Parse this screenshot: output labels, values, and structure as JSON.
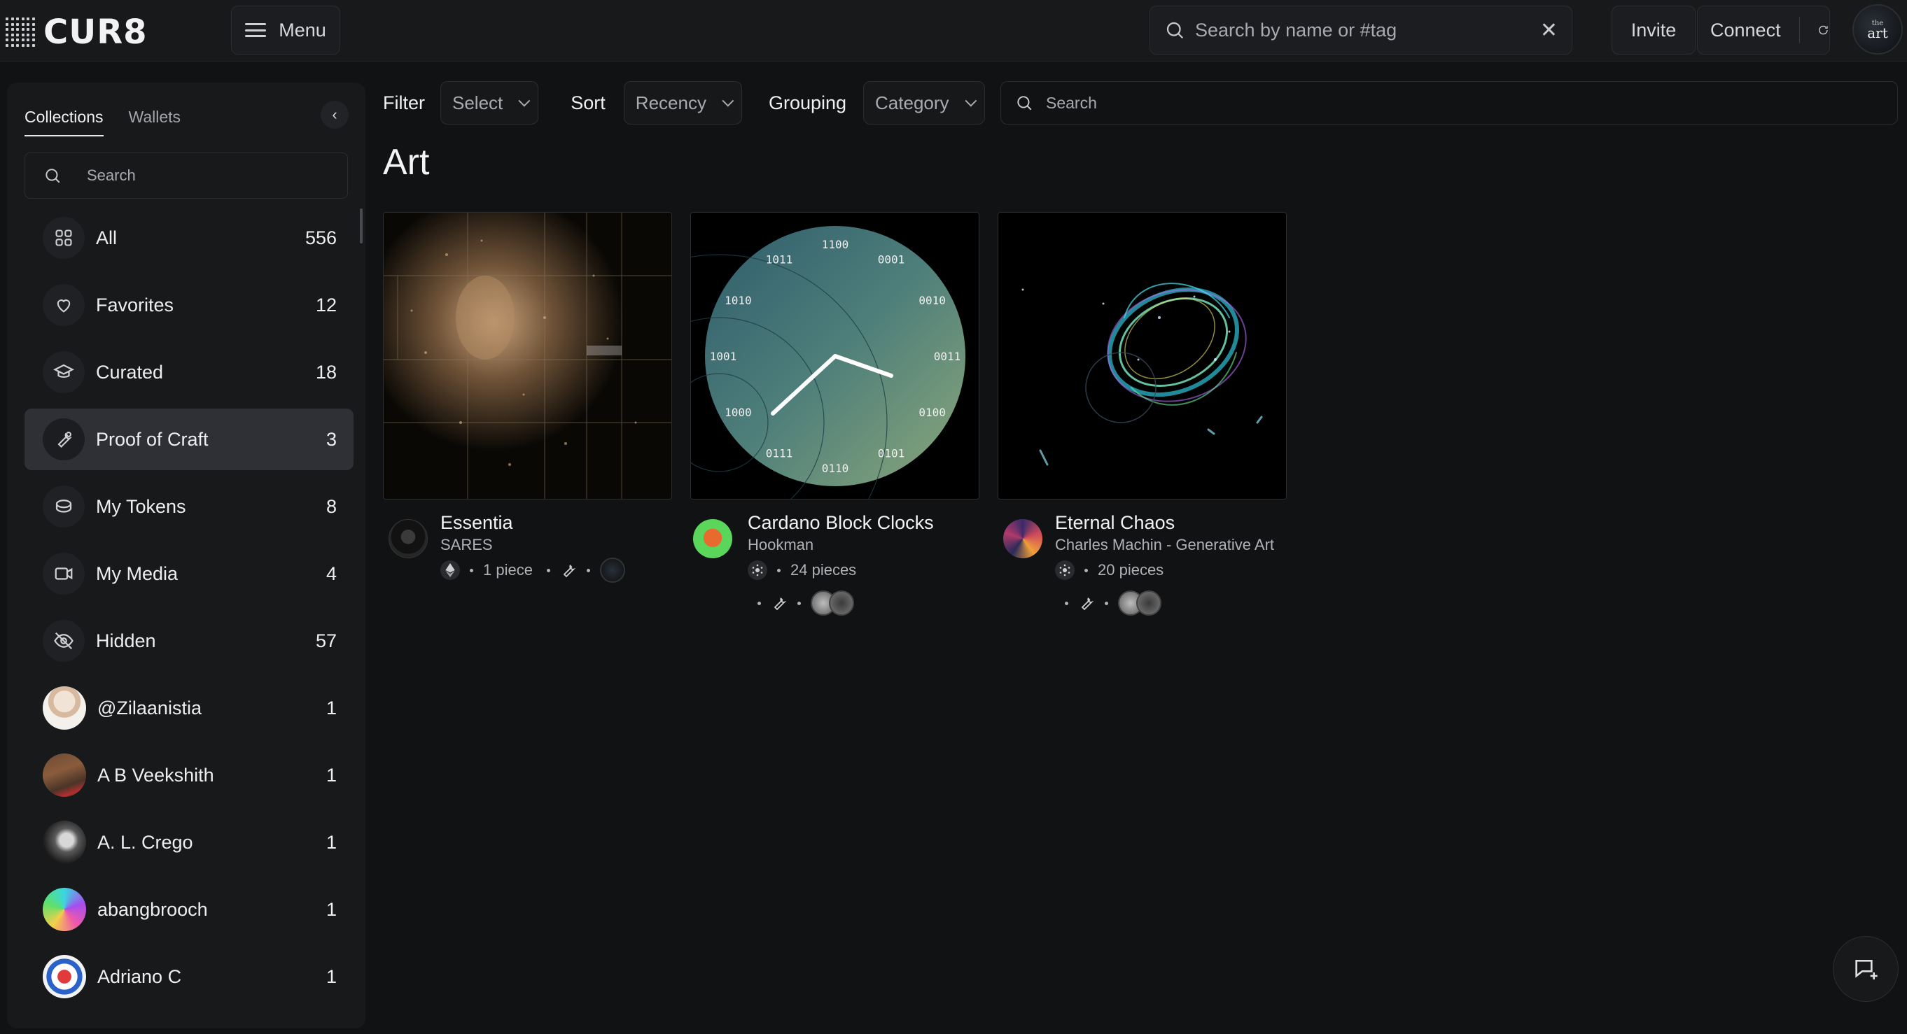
{
  "app": {
    "logo_text": "CUR8",
    "menu_label": "Menu",
    "search_placeholder": "Search by name or #tag",
    "invite_label": "Invite",
    "connect_label": "Connect",
    "avatar_text": "art",
    "avatar_small": "the"
  },
  "sidebar": {
    "tabs": [
      {
        "label": "Collections",
        "active": true
      },
      {
        "label": "Wallets",
        "active": false
      }
    ],
    "search_placeholder": "Search",
    "items": [
      {
        "label": "All",
        "count": "556",
        "icon": "grid-icon"
      },
      {
        "label": "Favorites",
        "count": "12",
        "icon": "heart-icon"
      },
      {
        "label": "Curated",
        "count": "18",
        "icon": "graduation-cap-icon"
      },
      {
        "label": "Proof of Craft",
        "count": "3",
        "icon": "wrench-icon",
        "active": true
      },
      {
        "label": "My Tokens",
        "count": "8",
        "icon": "coin-stack-icon"
      },
      {
        "label": "My Media",
        "count": "4",
        "icon": "video-camera-icon"
      },
      {
        "label": "Hidden",
        "count": "57",
        "icon": "eye-off-icon"
      },
      {
        "label": "@Zilaanistia",
        "count": "1",
        "icon": "avatar"
      },
      {
        "label": "A B Veekshith",
        "count": "1",
        "icon": "avatar"
      },
      {
        "label": "A. L. Crego",
        "count": "1",
        "icon": "avatar"
      },
      {
        "label": "abangbrooch",
        "count": "1",
        "icon": "avatar"
      },
      {
        "label": "Adriano C",
        "count": "1",
        "icon": "avatar"
      }
    ]
  },
  "filters": {
    "filter_label": "Filter",
    "filter_value": "Select",
    "sort_label": "Sort",
    "sort_value": "Recency",
    "grouping_label": "Grouping",
    "grouping_value": "Category",
    "search_placeholder": "Search"
  },
  "main": {
    "title": "Art",
    "cards": [
      {
        "title": "Essentia",
        "artist": "SARES",
        "pieces": "1 piece",
        "chain": "ethereum-icon"
      },
      {
        "title": "Cardano Block Clocks",
        "artist": "Hookman",
        "pieces": "24 pieces",
        "chain": "cardano-icon"
      },
      {
        "title": "Eternal Chaos",
        "artist": "Charles Machin - Generative Art",
        "pieces": "20 pieces",
        "chain": "cardano-icon"
      }
    ],
    "clock_labels": [
      "1100",
      "0001",
      "0010",
      "0011",
      "0100",
      "0101",
      "0110",
      "0111",
      "1000",
      "1001",
      "1010",
      "1011"
    ]
  },
  "colors": {
    "background": "#111214",
    "panel": "#18191b",
    "active_item": "#2e3036",
    "text": "#e8e8ea",
    "muted": "#a9aab0"
  }
}
